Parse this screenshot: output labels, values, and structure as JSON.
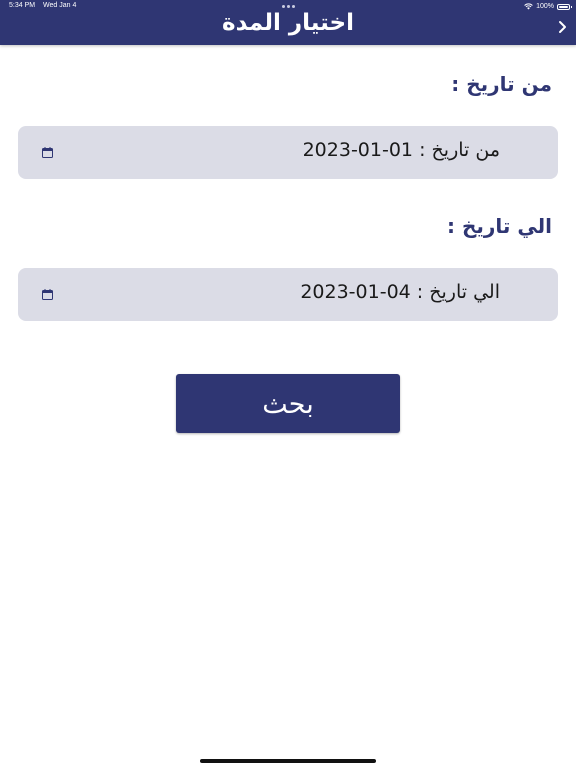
{
  "status_bar": {
    "time": "5:34 PM",
    "date": "Wed Jan 4",
    "battery": "100%"
  },
  "header": {
    "title": "اختيار المدة",
    "back_icon": "chevron-right-icon"
  },
  "from_date": {
    "label": "من تاريخ :",
    "field_text": "من تاريخ :  01-01-2023",
    "icon": "calendar-icon"
  },
  "to_date": {
    "label": "الي تاريخ :",
    "field_text": "الي تاريخ :  04-01-2023",
    "icon": "calendar-icon"
  },
  "search_button": {
    "label": "بحث"
  },
  "colors": {
    "primary": "#2f3673",
    "field_bg": "#dbdce6",
    "background": "#ffffff"
  }
}
